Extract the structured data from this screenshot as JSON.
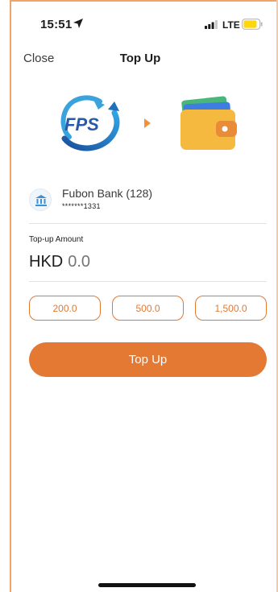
{
  "status_bar": {
    "time": "15:51",
    "network": "LTE",
    "location_icon": "location-arrow-icon",
    "signal_icon": "signal-bars-icon",
    "battery_icon": "battery-icon",
    "battery_color": "#ffd60a"
  },
  "nav": {
    "close_label": "Close",
    "title": "Top Up"
  },
  "transfer": {
    "source_logo_text": "FPS",
    "source_icon": "fps-logo-icon",
    "arrow_icon": "arrow-right-icon",
    "destination_icon": "wallet-icon"
  },
  "bank": {
    "icon": "bank-icon",
    "name": "Fubon Bank (128)",
    "account": "*******1331"
  },
  "amount": {
    "label": "Top-up Amount",
    "currency": "HKD",
    "placeholder": "0.0"
  },
  "presets": [
    "200.0",
    "500.0",
    "1,500.0"
  ],
  "action": {
    "label": "Top Up"
  },
  "colors": {
    "accent": "#e37932",
    "frame": "#f2a366"
  }
}
